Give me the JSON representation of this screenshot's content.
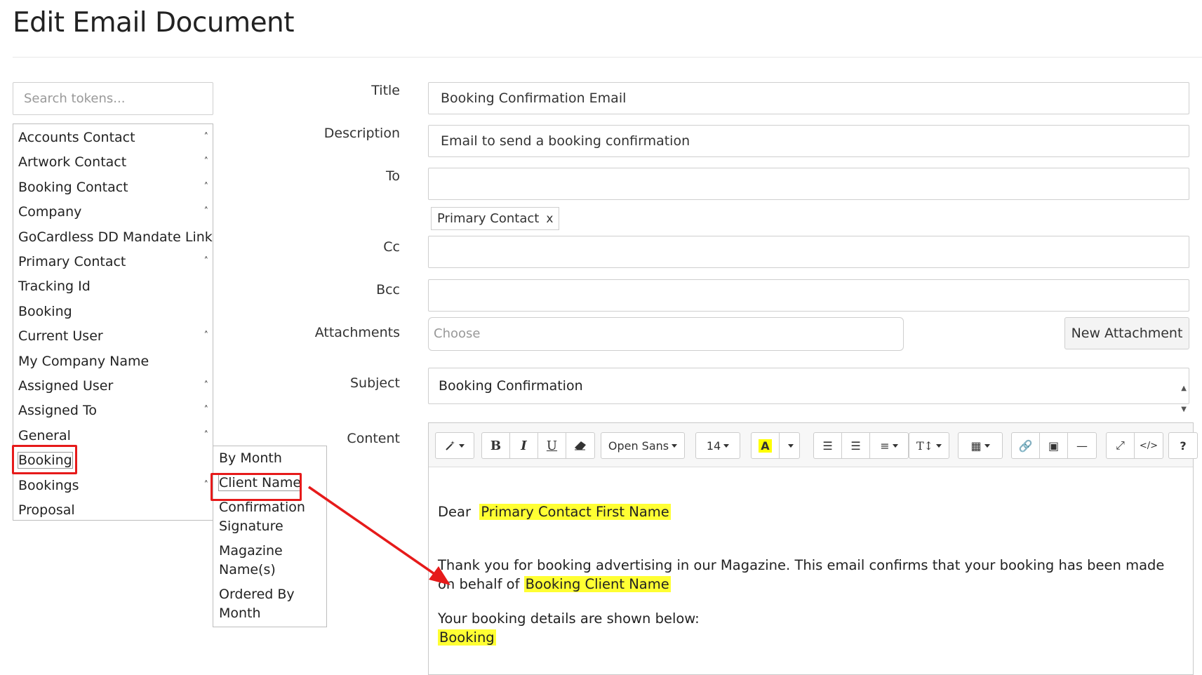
{
  "page": {
    "title": "Edit Email Document"
  },
  "tokens": {
    "search_placeholder": "Search tokens...",
    "items": [
      {
        "label": "Accounts Contact",
        "expandable": true
      },
      {
        "label": "Artwork Contact",
        "expandable": true
      },
      {
        "label": "Booking Contact",
        "expandable": true
      },
      {
        "label": "Company",
        "expandable": true
      },
      {
        "label": "GoCardless DD Mandate Link",
        "expandable": false
      },
      {
        "label": "Primary Contact",
        "expandable": true
      },
      {
        "label": "Tracking Id",
        "expandable": false
      },
      {
        "label": "Booking",
        "expandable": false
      },
      {
        "label": "Current User",
        "expandable": true
      },
      {
        "label": "My Company Name",
        "expandable": false
      },
      {
        "label": "Assigned User",
        "expandable": true
      },
      {
        "label": "Assigned To",
        "expandable": true
      },
      {
        "label": "General",
        "expandable": true
      },
      {
        "label": "Booking",
        "expandable": false,
        "highlighted": true
      },
      {
        "label": "Bookings",
        "expandable": true
      },
      {
        "label": "Proposal",
        "expandable": false
      }
    ],
    "caret": "˄",
    "submenu": [
      {
        "label": "By Month"
      },
      {
        "label": "Client Name",
        "highlighted": true
      },
      {
        "label": "Confirmation Signature"
      },
      {
        "label": "Magazine Name(s)"
      },
      {
        "label": "Ordered By Month"
      }
    ]
  },
  "form": {
    "title_label": "Title",
    "title_value": "Booking Confirmation Email",
    "description_label": "Description",
    "description_value": "Email to send a booking confirmation",
    "to_label": "To",
    "to_value": "",
    "to_chip": "Primary Contact",
    "chip_remove": "x",
    "cc_label": "Cc",
    "bcc_label": "Bcc",
    "attachments_label": "Attachments",
    "attachments_placeholder": "Choose",
    "new_attachment_label": "New Attachment",
    "subject_label": "Subject",
    "subject_value": "Booking Confirmation",
    "content_label": "Content"
  },
  "editor": {
    "font_name": "Open Sans",
    "font_size": "14",
    "bold": "B",
    "italic": "I",
    "underline": "U",
    "help": "?",
    "body": {
      "greeting": "Dear",
      "greeting_token": "Primary Contact First Name",
      "para1": "Thank you for booking advertising in our Magazine. This email confirms that your booking has been made on behalf of",
      "para1_token": "Booking Client Name",
      "para2": "Your booking details are shown below:",
      "para2_token": "Booking"
    }
  },
  "colors": {
    "highlight_box": "#e61a1a",
    "token_highlight": "#ffff33"
  }
}
